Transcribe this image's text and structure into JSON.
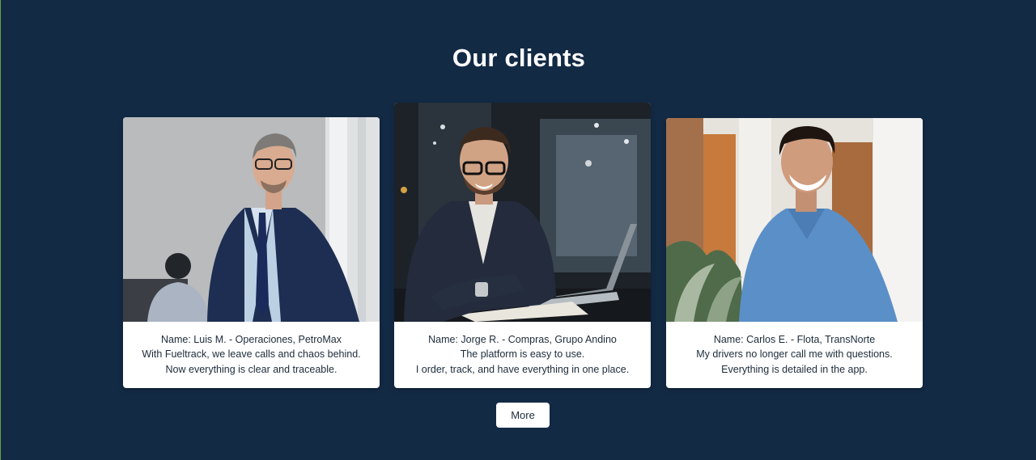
{
  "section": {
    "title": "Our clients"
  },
  "testimonials": [
    {
      "name_line": "Name: Luis M. - Operaciones, PetroMax",
      "quote_line1": "With Fueltrack, we leave calls and chaos behind.",
      "quote_line2": "Now everything is clear and traceable."
    },
    {
      "name_line": "Name: Jorge R. - Compras, Grupo Andino",
      "quote_line1": "The platform is easy to use.",
      "quote_line2": "I order, track, and have everything in one place."
    },
    {
      "name_line": "Name: Carlos E. - Flota, TransNorte",
      "quote_line1": "My drivers no longer call me with questions.",
      "quote_line2": "Everything is detailed in the app."
    }
  ],
  "actions": {
    "more_label": "More"
  },
  "colors": {
    "background": "#132a45",
    "card": "#ffffff",
    "text": "#1d2b3a"
  }
}
